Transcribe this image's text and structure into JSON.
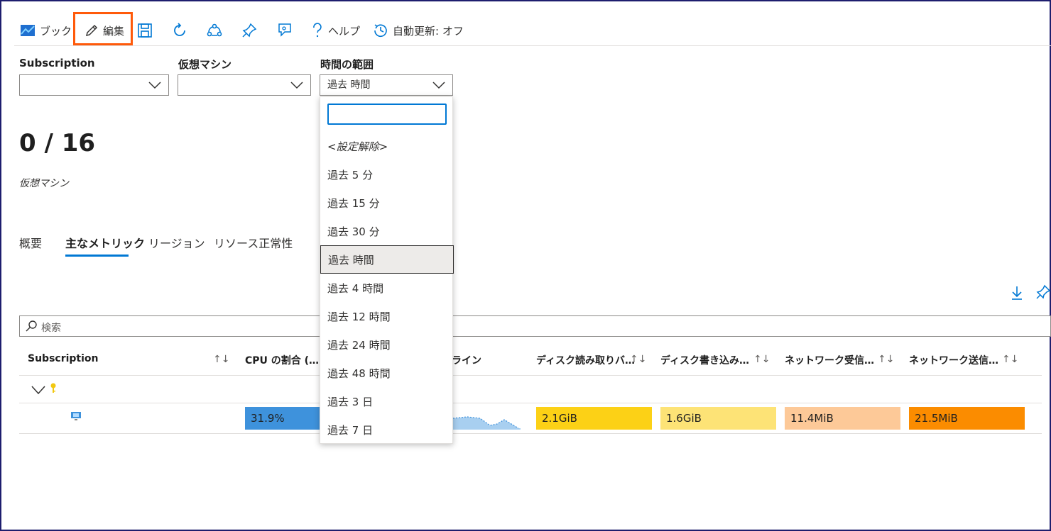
{
  "toolbar": {
    "book_label": "ブック",
    "edit_label": "編集",
    "help_label": "ヘルプ",
    "auto_refresh_label": "自動更新: オフ"
  },
  "params": {
    "subscription_label": "Subscription",
    "vm_label": "仮想マシン",
    "time_range_label": "時間の範囲",
    "time_range_value": "過去 時間"
  },
  "summary": {
    "count": "0 / 16",
    "caption": "仮想マシン"
  },
  "tabs": [
    "概要",
    "主なメトリック",
    "リージョン",
    "リソース正常性"
  ],
  "search": {
    "placeholder": "検索"
  },
  "table": {
    "headers": [
      "Subscription",
      "CPU の割合 (…",
      "ライン",
      "ディスク読み取りバ…",
      "ディスク書き込み…",
      "ネットワーク受信…",
      "ネットワーク送信…"
    ],
    "sort_glyph": "↑↓",
    "row": {
      "cpu": "31.9%",
      "disk_read": "2.1GiB",
      "disk_write": "1.6GiB",
      "net_in": "11.4MiB",
      "net_out": "21.5MiB"
    }
  },
  "dropdown": {
    "search_value": "",
    "items": [
      "<設定解除>",
      "過去 5 分",
      "過去 15 分",
      "過去 30 分",
      "過去 時間",
      "過去 4 時間",
      "過去 12 時間",
      "過去 24 時間",
      "過去 48 時間",
      "過去 3 日",
      "過去 7 日"
    ],
    "selected": "過去 時間"
  },
  "colors": {
    "accent": "#0078d4",
    "edit_highlight": "#ff5a0a",
    "cpu_bar": "#3e92dc",
    "disk_read": "#fcd116",
    "disk_write": "#fde376",
    "net_in": "#fdc998",
    "net_out": "#fb8c00"
  }
}
